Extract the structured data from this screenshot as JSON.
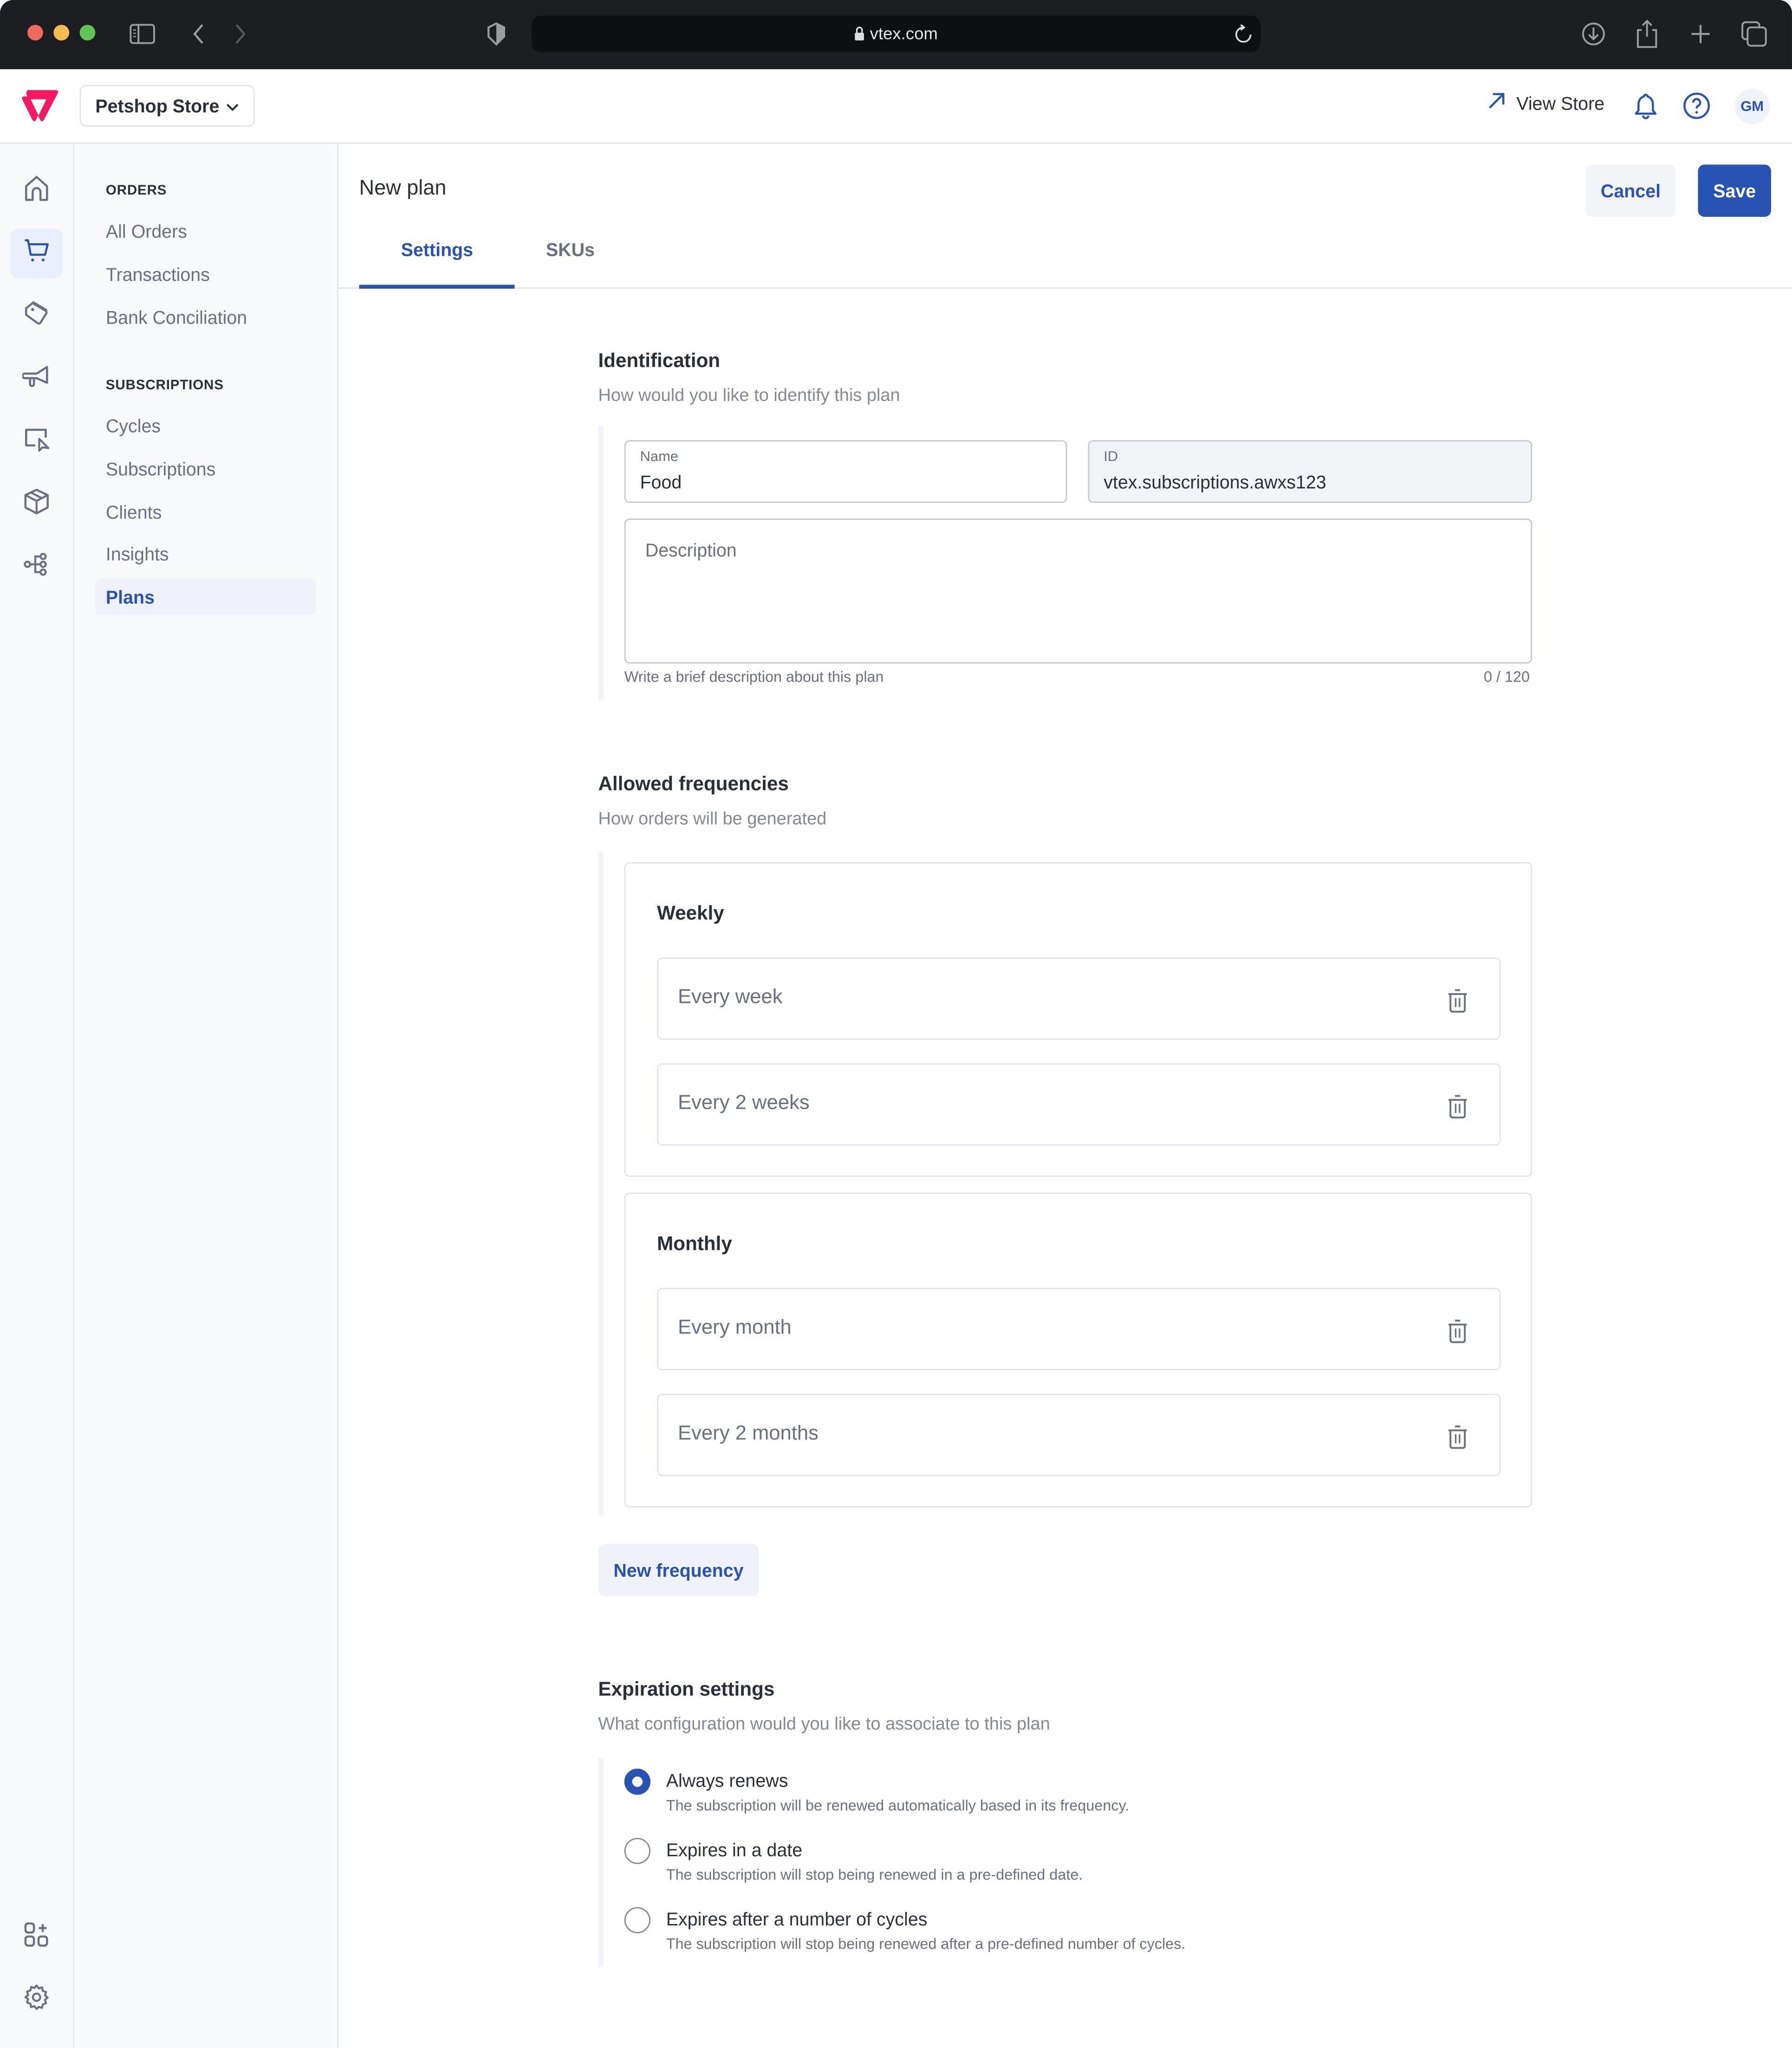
{
  "browser": {
    "url": "vtex.com",
    "icons": [
      "sidebar-toggle-icon",
      "back-icon",
      "forward-icon",
      "shield-icon",
      "lock-icon",
      "reload-icon",
      "download-icon",
      "share-icon",
      "new-tab-icon",
      "tabs-overview-icon"
    ]
  },
  "header": {
    "store_name": "Petshop Store",
    "view_store_label": "View Store",
    "avatar_initials": "GM",
    "brand_color": "#F71963",
    "accent_color": "#2953B2"
  },
  "rail": {
    "items": [
      {
        "icon": "home-icon",
        "active": false
      },
      {
        "icon": "cart-icon",
        "active": true
      },
      {
        "icon": "tag-icon",
        "active": false
      },
      {
        "icon": "megaphone-icon",
        "active": false
      },
      {
        "icon": "storefront-cursor-icon",
        "active": false
      },
      {
        "icon": "box-icon",
        "active": false
      },
      {
        "icon": "flow-icon",
        "active": false
      }
    ],
    "bottom_items": [
      {
        "icon": "apps-add-icon"
      },
      {
        "icon": "gear-icon"
      }
    ]
  },
  "subnav": {
    "sections": [
      {
        "heading": "ORDERS",
        "items": [
          "All Orders",
          "Transactions",
          "Bank Conciliation"
        ]
      },
      {
        "heading": "SUBSCRIPTIONS",
        "items": [
          "Cycles",
          "Subscriptions",
          "Clients",
          "Insights",
          "Plans"
        ]
      }
    ],
    "active_item": "Plans"
  },
  "page": {
    "title": "New plan",
    "cancel_label": "Cancel",
    "save_label": "Save",
    "tabs": [
      {
        "label": "Settings",
        "active": true
      },
      {
        "label": "SKUs",
        "active": false
      }
    ]
  },
  "identification": {
    "title": "Identification",
    "subtitle": "How would you like to identify this plan",
    "name_label": "Name",
    "name_value": "Food",
    "id_label": "ID",
    "id_value": "vtex.subscriptions.awxs123",
    "description_placeholder": "Description",
    "description_helper": "Write a brief description about this plan",
    "description_counter": "0 / 120"
  },
  "frequencies": {
    "title": "Allowed frequencies",
    "subtitle": "How orders will be generated",
    "groups": [
      {
        "title": "Weekly",
        "items": [
          "Every week",
          "Every 2 weeks"
        ]
      },
      {
        "title": "Monthly",
        "items": [
          "Every month",
          "Every 2 months"
        ]
      }
    ],
    "new_button_label": "New frequency"
  },
  "expiration": {
    "title": "Expiration settings",
    "subtitle": "What configuration would you like to associate to this plan",
    "options": [
      {
        "label": "Always renews",
        "description": "The subscription will be renewed automatically based in its frequency.",
        "selected": true
      },
      {
        "label": "Expires in a date",
        "description": "The subscription will stop being renewed in a pre-defined date.",
        "selected": false
      },
      {
        "label": "Expires after a number of cycles",
        "description": "The subscription will stop being renewed after a pre-defined number of cycles.",
        "selected": false
      }
    ]
  }
}
